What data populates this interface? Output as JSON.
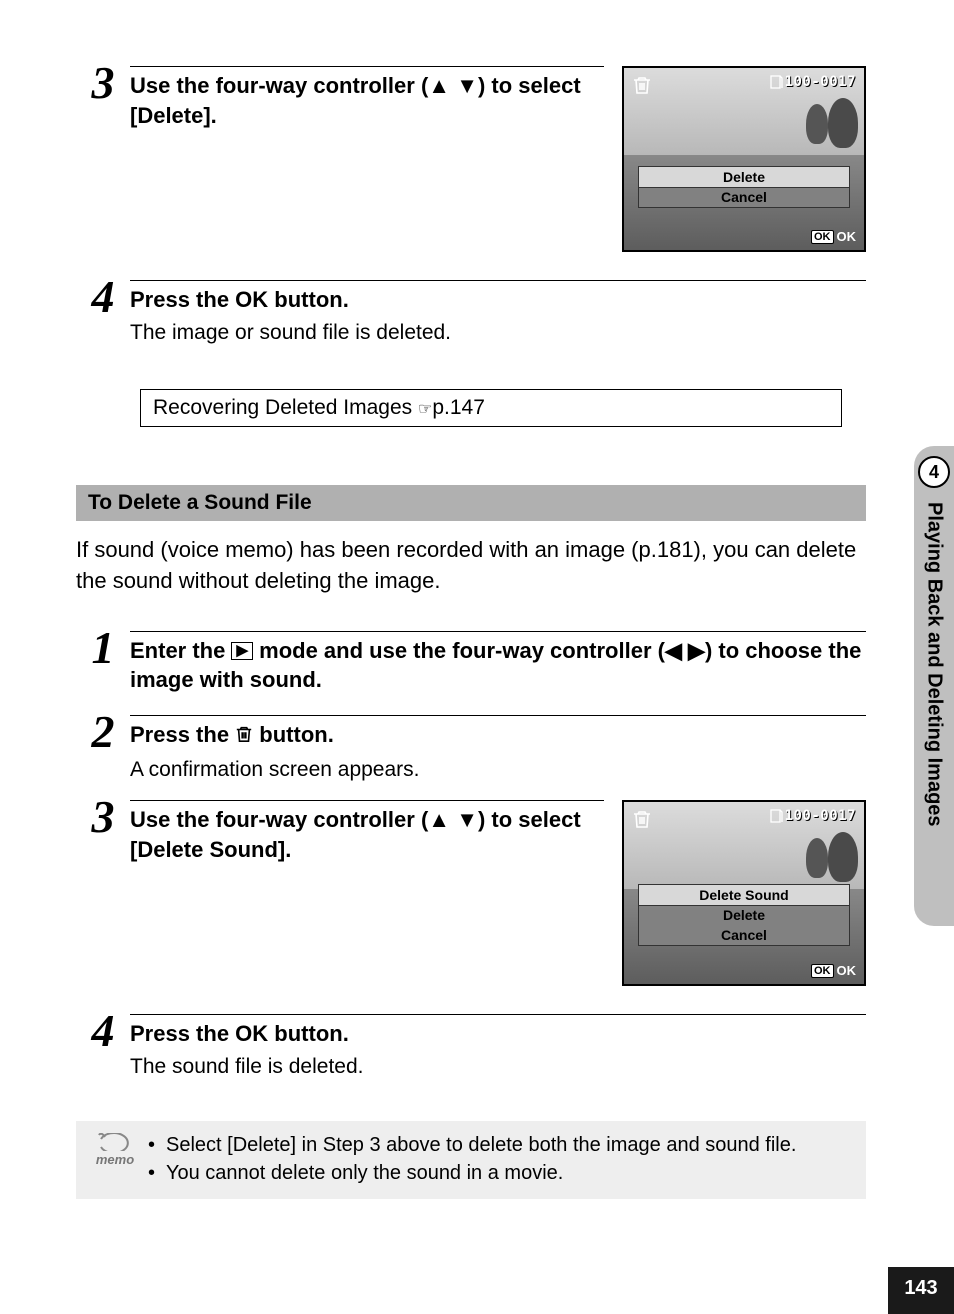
{
  "page_number": "143",
  "sidebar": {
    "chapter": "4",
    "label": "Playing Back and Deleting Images"
  },
  "section1": {
    "step3": {
      "num": "3",
      "head_a": "Use the four-way controller (",
      "head_b": ") to select [Delete]."
    },
    "lcd1": {
      "fileno": "100-0017",
      "menu": {
        "opt1": "Delete",
        "opt2": "Cancel"
      },
      "ok": "OK",
      "okbox": "OK"
    },
    "step4": {
      "num": "4",
      "head_a": "Press the ",
      "head_b": " button.",
      "ok": "OK",
      "desc": "The image or sound file is deleted."
    },
    "callout": {
      "text": "Recovering Deleted Images ",
      "page": "p.147"
    }
  },
  "subheading": "To Delete a Sound File",
  "intro_para": "If sound (voice memo) has been recorded with an image (p.181), you can delete the sound without deleting the image.",
  "section2": {
    "step1": {
      "num": "1",
      "head_a": "Enter the ",
      "head_b": " mode and use the four-way controller (",
      "head_c": ") to choose the image with sound."
    },
    "step2": {
      "num": "2",
      "head_a": "Press the ",
      "head_b": " button.",
      "desc": "A confirmation screen appears."
    },
    "lcd2": {
      "fileno": "100-0017",
      "menu": {
        "opt1": "Delete Sound",
        "opt2": "Delete",
        "opt3": "Cancel"
      },
      "ok": "OK",
      "okbox": "OK"
    },
    "step3": {
      "num": "3",
      "head_a": "Use the four-way controller (",
      "head_b": ") to select [Delete Sound]."
    },
    "step4": {
      "num": "4",
      "head_a": "Press the ",
      "head_b": " button.",
      "ok": "OK",
      "desc": "The sound file is deleted."
    }
  },
  "memo": {
    "label": "memo",
    "items": [
      "Select [Delete] in Step 3 above to delete both the image and sound file.",
      "You cannot delete only the sound in a movie."
    ]
  }
}
